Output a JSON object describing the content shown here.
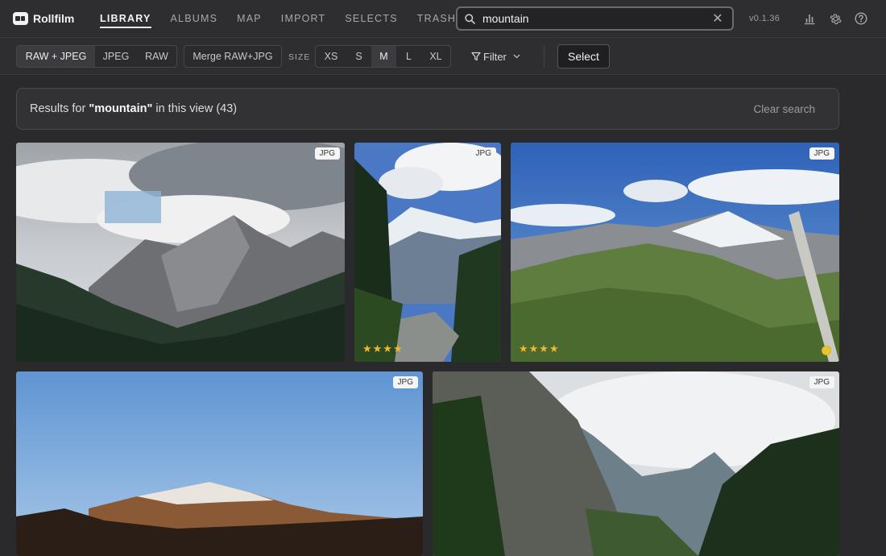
{
  "app": {
    "name": "Rollfilm",
    "version": "v0.1.36"
  },
  "nav": {
    "items": [
      {
        "label": "LIBRARY",
        "active": true
      },
      {
        "label": "ALBUMS",
        "active": false
      },
      {
        "label": "MAP",
        "active": false
      },
      {
        "label": "IMPORT",
        "active": false
      },
      {
        "label": "SELECTS",
        "active": false
      },
      {
        "label": "TRASH",
        "active": false
      }
    ]
  },
  "search": {
    "value": "mountain"
  },
  "toolbar": {
    "format_filters": [
      "RAW + JPEG",
      "JPEG",
      "RAW"
    ],
    "format_active": "RAW + JPEG",
    "merge_label": "Merge RAW+JPG",
    "size_label": "SIZE",
    "sizes": [
      "XS",
      "S",
      "M",
      "L",
      "XL"
    ],
    "size_active": "M",
    "filter_label": "Filter",
    "select_label": "Select"
  },
  "results": {
    "prefix": "Results for ",
    "query": "\"mountain\"",
    "suffix": " in this view (43)",
    "clear_label": "Clear search"
  },
  "photos": [
    {
      "badge": "JPG",
      "stars": "",
      "color_label": false
    },
    {
      "badge": "JPG",
      "stars": "★★★★",
      "color_label": false
    },
    {
      "badge": "JPG",
      "stars": "★★★★",
      "color_label": true
    },
    {
      "badge": "JPG",
      "stars": "",
      "color_label": false
    },
    {
      "badge": "JPG",
      "stars": "",
      "color_label": false
    }
  ],
  "colors": {
    "star": "#f2b72e",
    "color_label": "#e8c630",
    "accent": "#e8e8e8"
  },
  "icons": {
    "search": "search-icon",
    "clear": "close-icon",
    "stats": "bar-chart-icon",
    "settings": "gear-icon",
    "help": "help-icon",
    "filter": "funnel-icon"
  }
}
